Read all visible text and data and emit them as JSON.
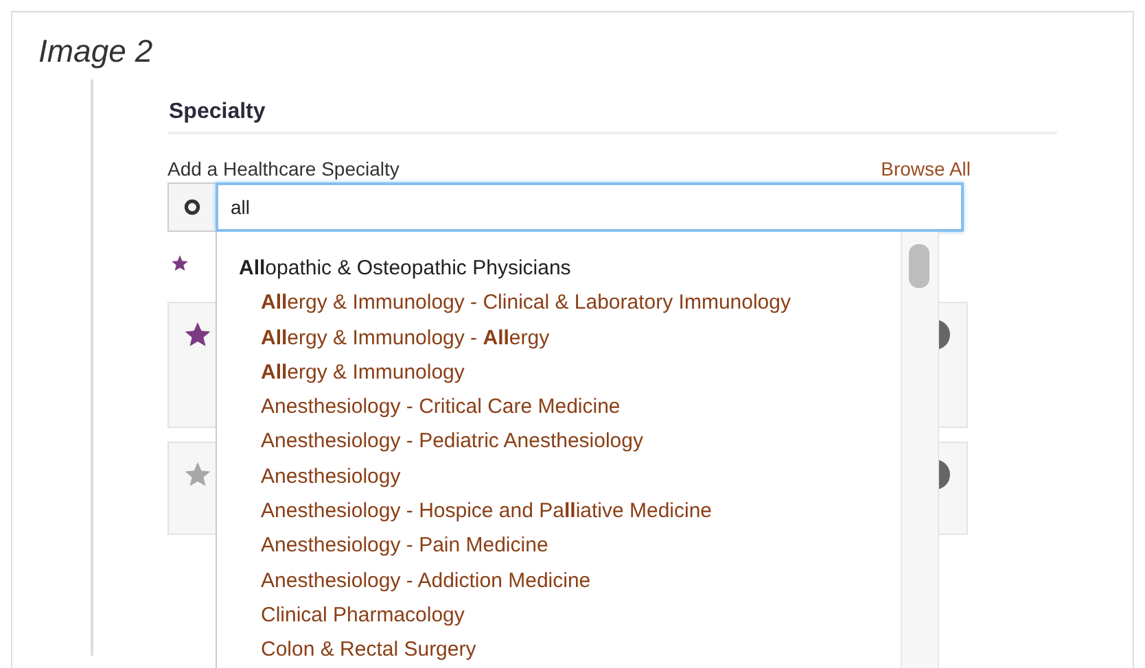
{
  "caption": "Image 2",
  "section": {
    "title": "Specialty",
    "field_label": "Add a Healthcare Specialty",
    "browse_link": "Browse All"
  },
  "search": {
    "value": "all"
  },
  "cards": [
    {
      "starred": true
    },
    {
      "starred": false
    }
  ],
  "suggestions": [
    {
      "kind": "group",
      "label": "**All**opathic & Osteopathic Physicians",
      "children": [
        {
          "kind": "option",
          "label": "**All**ergy & Immunology - Clinical & Laboratory Immunology"
        },
        {
          "kind": "option",
          "label": "**All**ergy & Immunology - **All**ergy"
        },
        {
          "kind": "option",
          "label": "**All**ergy & Immunology"
        },
        {
          "kind": "option",
          "label": "Anesthesiology - Critical Care Medicine"
        },
        {
          "kind": "option",
          "label": "Anesthesiology - Pediatric Anesthesiology"
        },
        {
          "kind": "option",
          "label": "Anesthesiology"
        },
        {
          "kind": "option",
          "label": "Anesthesiology - Hospice and Pa**ll**iative Medicine"
        },
        {
          "kind": "option",
          "label": "Anesthesiology - Pain Medicine"
        },
        {
          "kind": "option",
          "label": "Anesthesiology - Addiction Medicine"
        },
        {
          "kind": "option",
          "label": "Clinical Pharmacology"
        },
        {
          "kind": "option",
          "label": "Colon & Rectal Surgery"
        }
      ]
    }
  ]
}
